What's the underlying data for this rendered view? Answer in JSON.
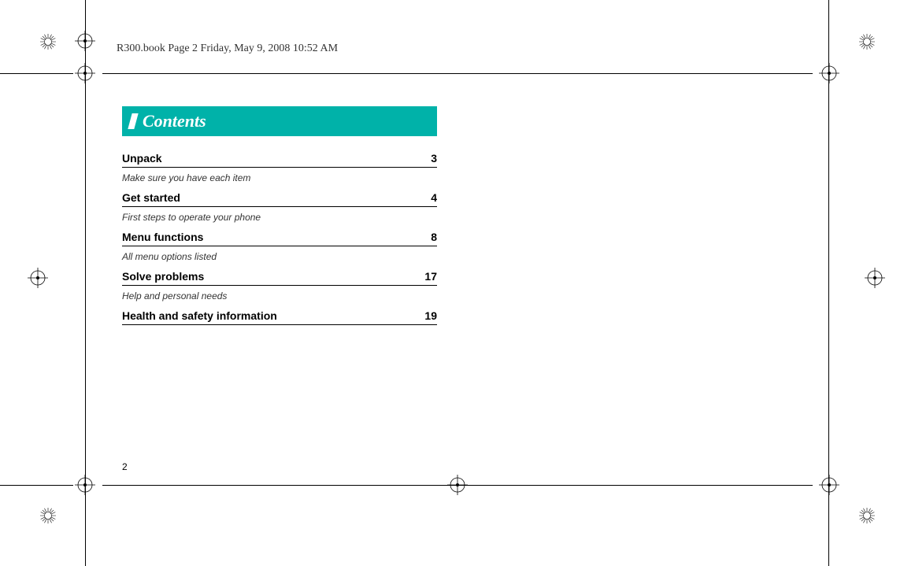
{
  "header": {
    "text": "R300.book  Page 2  Friday, May 9, 2008  10:52 AM"
  },
  "banner": {
    "title": "Contents"
  },
  "toc": [
    {
      "title": "Unpack",
      "page": "3",
      "desc": "Make sure you have each item"
    },
    {
      "title": "Get started",
      "page": "4",
      "desc": "First steps to operate your phone"
    },
    {
      "title": "Menu functions",
      "page": "8",
      "desc": "All menu options listed"
    },
    {
      "title": "Solve problems",
      "page": "17",
      "desc": "Help and personal needs"
    },
    {
      "title": "Health and safety information",
      "page": "19",
      "desc": ""
    }
  ],
  "pageNumber": "2"
}
